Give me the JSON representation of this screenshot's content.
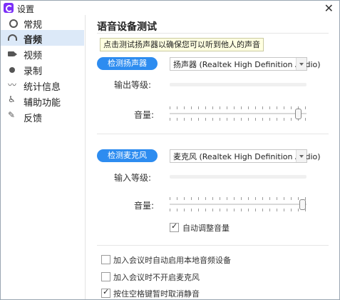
{
  "window": {
    "title": "设置"
  },
  "sidebar": {
    "items": [
      {
        "label": "常规",
        "icon": "gear-icon",
        "active": false
      },
      {
        "label": "音频",
        "icon": "headphones-icon",
        "active": true
      },
      {
        "label": "视频",
        "icon": "video-camera-icon",
        "active": false
      },
      {
        "label": "录制",
        "icon": "record-icon",
        "active": false
      },
      {
        "label": "统计信息",
        "icon": "pulse-icon",
        "active": false
      },
      {
        "label": "辅助功能",
        "icon": "accessibility-icon",
        "active": false
      },
      {
        "label": "反馈",
        "icon": "feedback-icon",
        "active": false
      }
    ]
  },
  "main": {
    "title": "语音设备测试",
    "tooltip": "点击测试扬声器以确保您可以听到他人的声音",
    "speaker": {
      "test_button": "检测扬声器",
      "device": "扬声器 (Realtek High Definition Audio)",
      "output_label": "输出等级:",
      "output_level": 0,
      "volume_label": "音量:",
      "volume": 0.94
    },
    "mic": {
      "test_button": "检测麦克风",
      "device": "麦克风 (Realtek High Definition Audio)",
      "input_label": "输入等级:",
      "input_level": 0,
      "volume_label": "音量:",
      "volume": 0.97,
      "auto_adjust_label": "自动调整音量",
      "auto_adjust": true
    },
    "options": [
      {
        "label": "加入会议时自动启用本地音频设备",
        "checked": false
      },
      {
        "label": "加入会议时不开启麦克风",
        "checked": false
      },
      {
        "label": "按住空格键暂时取消静音",
        "checked": true
      }
    ]
  }
}
